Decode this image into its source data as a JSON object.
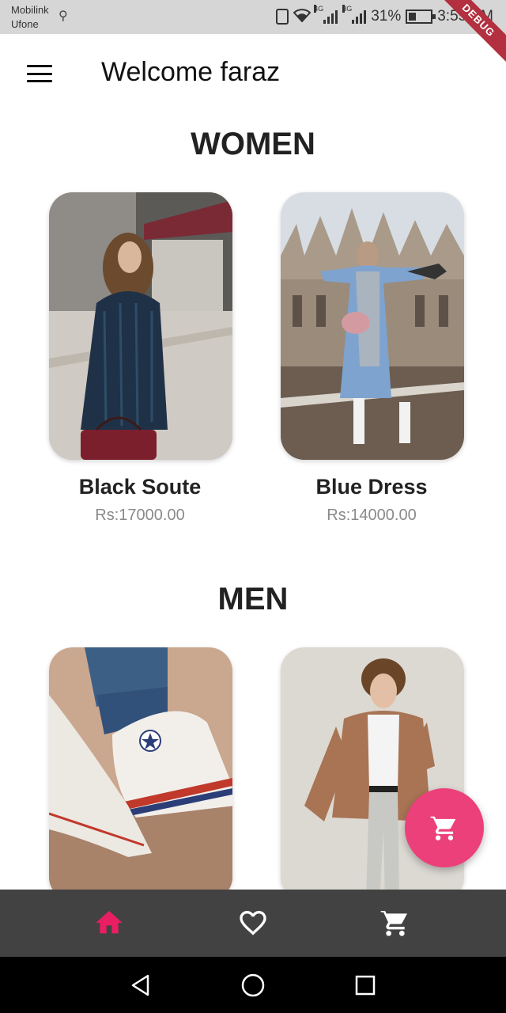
{
  "status_bar": {
    "carrier_1": "Mobilink",
    "carrier_2": "Ufone",
    "network_1": "4G",
    "network_2": "3G",
    "battery": "31%",
    "time": "3:55 PM",
    "debug": "DEBUG"
  },
  "app_bar": {
    "title": "Welcome faraz",
    "menu_icon": "hamburger-menu-icon"
  },
  "sections": [
    {
      "title": "WOMEN",
      "products": [
        {
          "name": "Black Soute",
          "price": "Rs:17000.00"
        },
        {
          "name": "Blue Dress",
          "price": "Rs:14000.00"
        }
      ]
    },
    {
      "title": "MEN",
      "products": []
    }
  ],
  "fab": {
    "icon": "shopping-cart-icon",
    "color": "#ec407a"
  },
  "bottom_nav": {
    "items": [
      {
        "icon": "home-icon",
        "active": true
      },
      {
        "icon": "heart-outline-icon",
        "active": false
      },
      {
        "icon": "shopping-cart-icon",
        "active": false
      }
    ],
    "active_color": "#e91e63",
    "background": "#424242"
  },
  "system_nav": [
    "back-icon",
    "home-circle-icon",
    "recents-icon"
  ]
}
